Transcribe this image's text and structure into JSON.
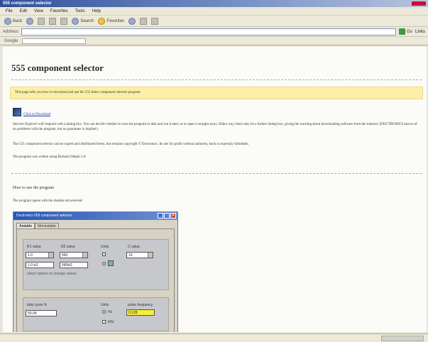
{
  "browser": {
    "title": "555 component selector",
    "menu": [
      "File",
      "Edit",
      "View",
      "Favorites",
      "Tools",
      "Help"
    ],
    "toolbar": {
      "back_label": "Back",
      "search_label": "Search",
      "favorites_label": "Favorites"
    },
    "address": {
      "label": "Address",
      "go_label": "Go",
      "links_label": "Links"
    },
    "links_bar": {
      "label": "Google"
    }
  },
  "page": {
    "title": "555 component selector",
    "intro": "This page tells you how to download and use the 555 timer component selector program",
    "download": {
      "link_text": "Click to Download"
    },
    "para_security_lead": "Internet Explorer",
    "para_security": "will respond with a dialog box. You can decide whether to save the program to disk and run it later, or to open it straight away. Either way, there may be a further dialog box, giving the warning about downloading software from the internet. (DOCTRONICS knows of no problems with the program, but no guarantee is implied.)",
    "para_copyright": "The 555 component selector can be copied and distributed freely, but remains copyright © Doctronics. Its use for profit without authority, hack is expressly forbidden.",
    "para_written": "The program was written using Borland Delphi 2.0.",
    "section_heading": "How to use the program",
    "section_text": "The program opens with the Astable tab selected:"
  },
  "app": {
    "title": "Doctronics 555 component selector",
    "tabs": [
      "Astable",
      "Monostable"
    ],
    "r1_label": "R1 value",
    "r1_value": "1.0",
    "r2_label": "R2 value",
    "r2_value": "560",
    "units_label": "Units",
    "c_label": "C value",
    "c_value": "10",
    "r1_readout": "1.0 kΩ",
    "r2_readout": "560kΩ",
    "hint_text": "select options to change values",
    "duty_label": "duty cycle %",
    "duty_value": "50.04",
    "freq_units_label": "Units",
    "freq_label": "pulse frequency",
    "freq_value": "0.128",
    "radio_hz": "Hz",
    "radio_khz": "kHz"
  }
}
